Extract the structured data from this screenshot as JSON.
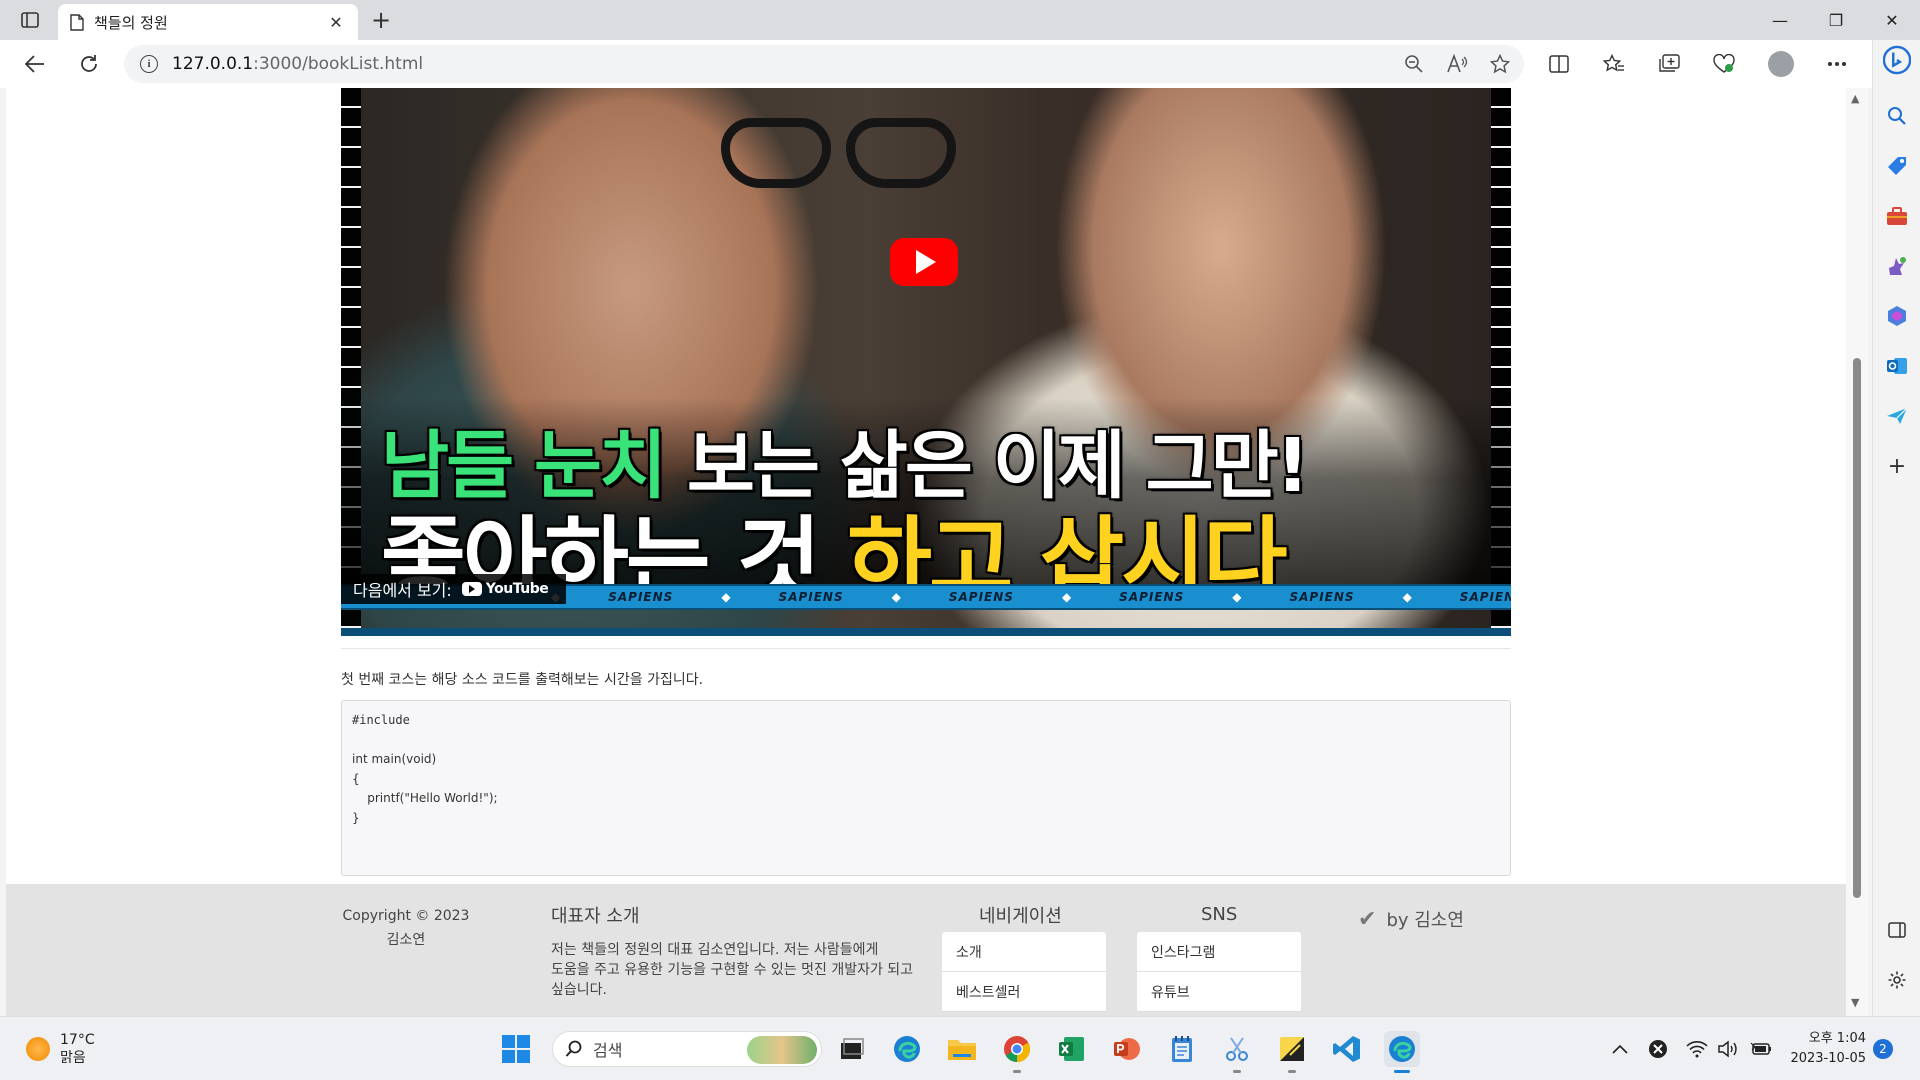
{
  "browser": {
    "tab_title": "책들의 정원",
    "tab_close": "✕",
    "new_tab": "+",
    "url_host": "127.0.0.1",
    "url_path": ":3000/bookList.html",
    "window_controls": {
      "minimize": "—",
      "restore": "❐",
      "close": "✕"
    }
  },
  "video": {
    "headline_1": {
      "green": "남들 눈치",
      "white": " 보는 삶은 이제 그만!"
    },
    "headline_2": {
      "white": "좋아하는 것 ",
      "yellow": "하고 삽시다"
    },
    "watch_on_label": "다음에서 보기:",
    "watch_on_brand": "YouTube",
    "strip_text": "SAPIENS",
    "colors": {
      "green": "#39e37a",
      "yellow": "#ffd21f",
      "play": "#ff0000",
      "strip": "#1a8fd0"
    }
  },
  "content": {
    "course_description": "첫 번째 코스는 해당 소스 코드를 출력해보는 시간을 가집니다.",
    "code_lines": [
      "#include",
      "",
      "int main(void)",
      "{",
      "    printf(\"Hello World!\");",
      "}"
    ]
  },
  "footer": {
    "copyright_line1": "Copyright © 2023",
    "copyright_line2": "김소연",
    "intro_heading": "대표자 소개",
    "intro_text": "저는 책들의 정원의 대표 김소연입니다. 저는 사람들에게 도움을 주고 유용한 기능을 구현할 수 있는 멋진 개발자가 되고 싶습니다.",
    "nav_heading": "네비게이션",
    "nav_items": [
      "소개",
      "베스트셀러"
    ],
    "sns_heading": "SNS",
    "sns_items": [
      "인스타그램",
      "유튜브"
    ],
    "byline": "by 김소연"
  },
  "taskbar": {
    "temperature": "17°C",
    "weather": "맑음",
    "search_label": "검색",
    "time": "오후 1:04",
    "date": "2023-10-05",
    "notification_count": "2"
  }
}
